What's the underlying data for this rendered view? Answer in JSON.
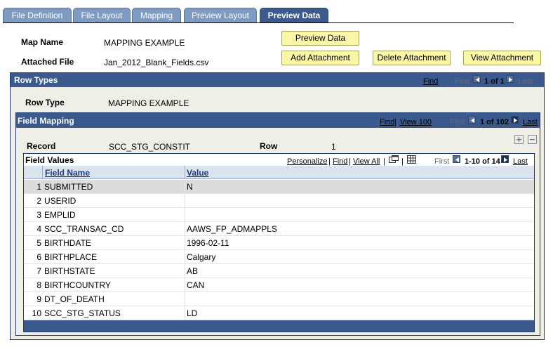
{
  "tabs": [
    {
      "label": "File Definition",
      "active": false
    },
    {
      "label": "File Layout",
      "active": false
    },
    {
      "label": "Mapping",
      "active": false
    },
    {
      "label": "Preview Layout",
      "active": false
    },
    {
      "label": "Preview Data",
      "active": true
    }
  ],
  "header": {
    "map_name_label": "Map Name",
    "map_name_value": "MAPPING EXAMPLE",
    "attached_file_label": "Attached File",
    "attached_file_value": "Jan_2012_Blank_Fields.csv"
  },
  "buttons": {
    "preview_data": "Preview Data",
    "add_attachment": "Add Attachment",
    "delete_attachment": "Delete Attachment",
    "view_attachment": "View Attachment"
  },
  "row_types": {
    "title": "Row Types",
    "find": "Find",
    "first": "First",
    "count": "1 of 1",
    "last": "Last",
    "row_type_label": "Row Type",
    "row_type_value": "MAPPING EXAMPLE"
  },
  "field_mapping": {
    "title": "Field Mapping",
    "find": "Find",
    "view100": "View 100",
    "first": "First",
    "count": "1 of 102",
    "last": "Last",
    "record_label": "Record",
    "record_value": "SCC_STG_CONSTIT",
    "row_label": "Row",
    "row_value": "1"
  },
  "field_values": {
    "title": "Field Values",
    "personalize": "Personalize",
    "find": "Find",
    "view_all": "View All",
    "first": "First",
    "count": "1-10 of 14",
    "last": "Last",
    "col_field_name": "Field Name",
    "col_value": "Value",
    "rows": [
      {
        "n": "1",
        "name": "SUBMITTED",
        "value": "N"
      },
      {
        "n": "2",
        "name": "USERID",
        "value": ""
      },
      {
        "n": "3",
        "name": "EMPLID",
        "value": ""
      },
      {
        "n": "4",
        "name": "SCC_TRANSAC_CD",
        "value": "AAWS_FP_ADMAPPLS"
      },
      {
        "n": "5",
        "name": "BIRTHDATE",
        "value": "1996-02-11"
      },
      {
        "n": "6",
        "name": "BIRTHPLACE",
        "value": "Calgary"
      },
      {
        "n": "7",
        "name": "BIRTHSTATE",
        "value": "AB"
      },
      {
        "n": "8",
        "name": "BIRTHCOUNTRY",
        "value": "CAN"
      },
      {
        "n": "9",
        "name": "DT_OF_DEATH",
        "value": ""
      },
      {
        "n": "10",
        "name": "SCC_STG_STATUS",
        "value": "LD"
      }
    ]
  }
}
